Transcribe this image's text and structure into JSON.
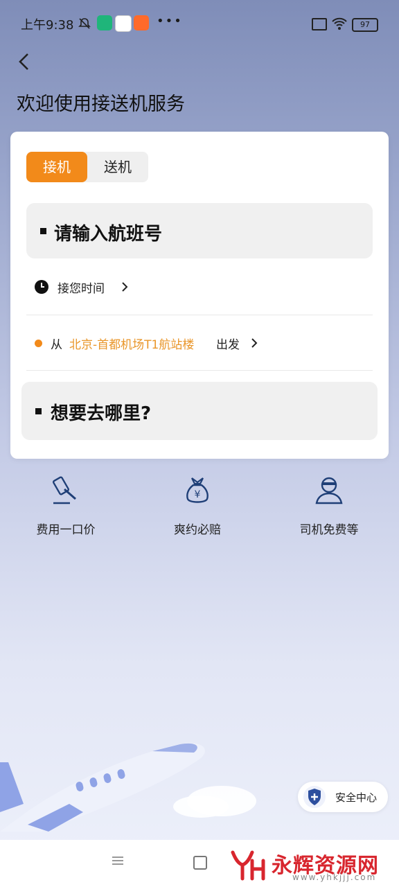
{
  "status_bar": {
    "time": "上午9:38",
    "battery": "97",
    "more": "•••"
  },
  "header": {
    "title": "欢迎使用接送机服务"
  },
  "tabs": [
    {
      "label": "接机",
      "active": true
    },
    {
      "label": "送机",
      "active": false
    }
  ],
  "flight_input": {
    "placeholder": "请输入航班号"
  },
  "pickup_time": {
    "label": "接您时间"
  },
  "departure": {
    "prefix": "从",
    "location": "北京-首都机场T1航站楼",
    "suffix": "出发"
  },
  "destination": {
    "placeholder": "想要去哪里?"
  },
  "features": [
    {
      "label": "费用一口价",
      "icon": "hammer-icon"
    },
    {
      "label": "爽约必赔",
      "icon": "money-bag-icon"
    },
    {
      "label": "司机免费等",
      "icon": "driver-icon"
    }
  ],
  "safety": {
    "label": "安全中心"
  },
  "watermark": {
    "text": "永辉资源网",
    "url": "www.yhkjjj.com"
  },
  "colors": {
    "accent": "#f28a1a",
    "icon_blue": "#1f3f77"
  }
}
